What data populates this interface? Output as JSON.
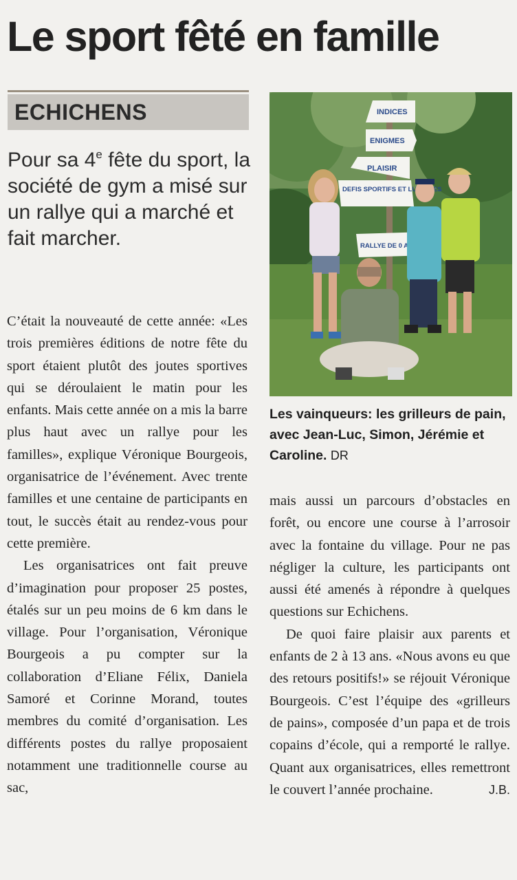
{
  "headline": "Le sport fêté en famille",
  "kicker": "ECHICHENS",
  "lead": {
    "part1": "Pour sa 4",
    "sup": "e",
    "part2": " fête du sport, la société de gym a misé sur un rallye qui a marché et fait marcher."
  },
  "photo": {
    "signs": [
      "INDICES",
      "ENIGMES",
      "PLAISIR",
      "DEFIS SPORTIFS ET LUDIQUES",
      "RALLYE DE 0 A 99 ANS"
    ]
  },
  "caption": {
    "text": "Les vainqueurs: les grilleurs de pain, avec Jean-Luc, Simon, Jérémie et Caroline.",
    "credit": "DR"
  },
  "body": {
    "p1": "C’était la nouveauté de cette année: «Les trois premières éditions de notre fête du sport étaient plutôt des joutes sportives qui se déroulaient le matin pour les enfants. Mais cette année on a mis la barre plus haut avec un rallye pour les familles», explique Véronique Bourgeois, organisatrice de l’événement. Avec trente familles et une centaine de participants en tout, le succès était au rendez-vous pour cette première.",
    "p2": "Les organisatrices ont fait preuve d’imagination pour proposer 25 postes, étalés sur un peu moins de 6 km dans le village. Pour l’organisation, Véronique Bourgeois a pu compter sur la collaboration d’Eliane Félix, Daniela Samoré et Corinne Morand, toutes membres du comité d’organisation. Les différents postes du rallye proposaient notamment une traditionnelle course au sac,",
    "p2_cont": "mais aussi un parcours d’obstacles en forêt, ou encore une course à l’arrosoir avec la fontaine du village. Pour ne pas négliger la culture, les participants ont aussi été amenés à répondre à quelques questions sur Echichens.",
    "p3": "De quoi faire plaisir aux parents et enfants de 2 à 13 ans. «Nous avons eu que des retours positifs!» se réjouit Véronique Bourgeois. C’est l’équipe des «grilleurs de pains», composée d’un papa et de trois copains d’école, qui a remporté le rallye. Quant aux organisatrices, elles remettront le couvert l’année prochaine.",
    "signature": "J.B."
  }
}
